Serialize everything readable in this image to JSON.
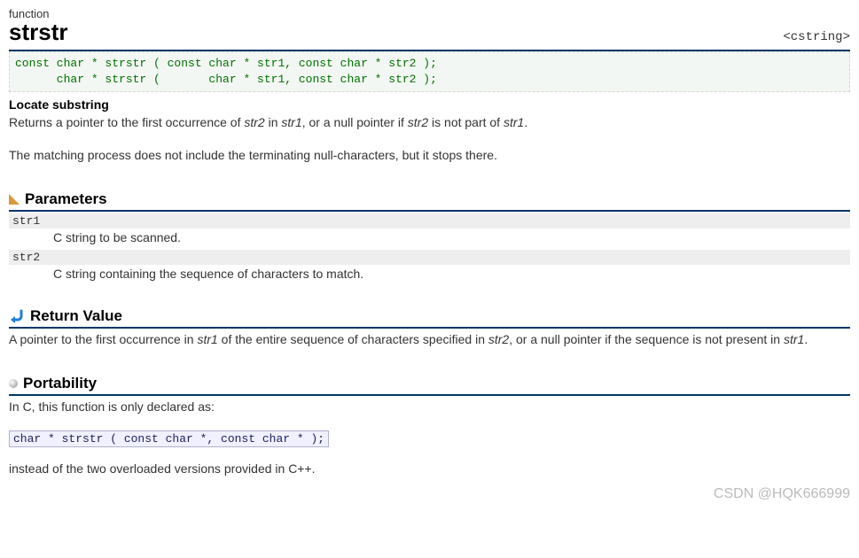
{
  "type_label": "function",
  "name": "strstr",
  "include": "<cstring>",
  "prototypes": "const char * strstr ( const char * str1, const char * str2 );\n      char * strstr (       char * str1, const char * str2 );",
  "brief": "Locate substring",
  "desc1_pre": "Returns a pointer to the first occurrence of ",
  "desc1_it1": "str2",
  "desc1_mid1": " in ",
  "desc1_it2": "str1",
  "desc1_mid2": ", or a null pointer if ",
  "desc1_it3": "str2",
  "desc1_mid3": " is not part of ",
  "desc1_it4": "str1",
  "desc1_post": ".",
  "desc2": "The matching process does not include the terminating null-characters, but it stops there.",
  "sec_parameters": "Parameters",
  "params": {
    "p1_name": "str1",
    "p1_desc": "C string to be scanned.",
    "p2_name": "str2",
    "p2_desc": "C string containing the sequence of characters to match."
  },
  "sec_return": "Return Value",
  "ret_pre": "A pointer to the first occurrence in ",
  "ret_it1": "str1",
  "ret_mid1": " of the entire sequence of characters specified in ",
  "ret_it2": "str2",
  "ret_mid2": ", or a null pointer if the sequence is not present in ",
  "ret_it3": "str1",
  "ret_post": ".",
  "sec_port": "Portability",
  "port_intro": "In C, this function is only declared as:",
  "port_code": "char * strstr ( const char *, const char * );",
  "port_out": "instead of the two overloaded versions provided in C++.",
  "watermark": "CSDN @HQK666999"
}
